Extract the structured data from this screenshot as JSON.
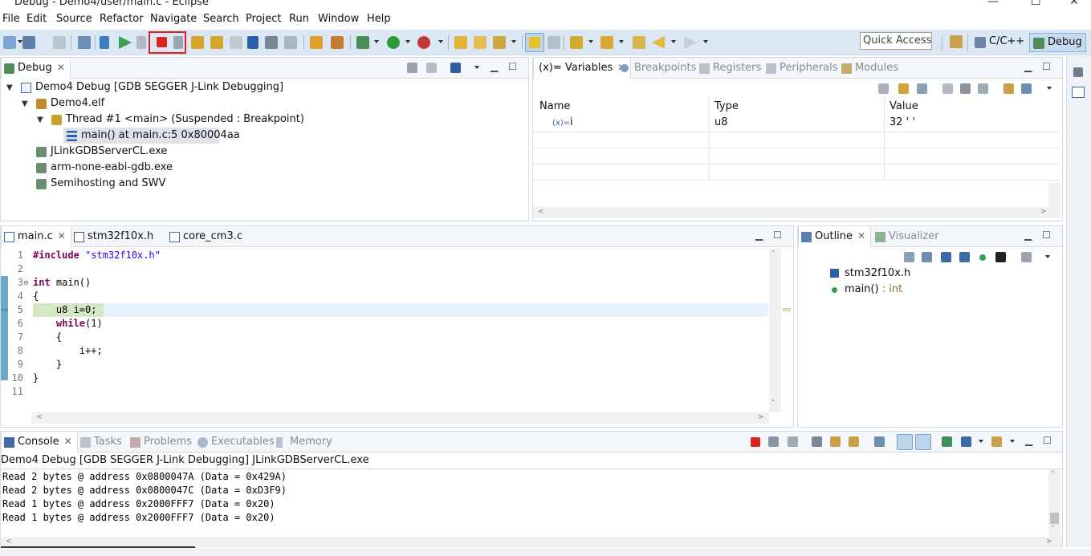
{
  "window": {
    "title": "Debug - Demo4/user/main.c - Eclipse"
  },
  "menu": [
    "File",
    "Edit",
    "Source",
    "Refactor",
    "Navigate",
    "Search",
    "Project",
    "Run",
    "Window",
    "Help"
  ],
  "toolbar": {
    "quick_access_placeholder": "Quick Access",
    "perspectives": [
      "C/C++",
      "Debug"
    ],
    "active_perspective": "Debug",
    "highlighted_button": "terminate-button"
  },
  "debug_view": {
    "tab_label": "Debug",
    "tree": [
      {
        "label": "Demo4 Debug [GDB SEGGER J-Link Debugging]",
        "level": 0,
        "icon": "launch-config-icon"
      },
      {
        "label": "Demo4.elf",
        "level": 1,
        "icon": "process-icon"
      },
      {
        "label": "Thread #1 <main> (Suspended : Breakpoint)",
        "level": 2,
        "icon": "thread-icon"
      },
      {
        "label": "main() at main.c:5 0x80004aa",
        "level": 3,
        "icon": "stack-frame-icon",
        "selected": true
      },
      {
        "label": "JLinkGDBServerCL.exe",
        "level": 1,
        "icon": "process-icon"
      },
      {
        "label": "arm-none-eabi-gdb.exe",
        "level": 1,
        "icon": "process-icon"
      },
      {
        "label": "Semihosting and SWV",
        "level": 1,
        "icon": "process-icon"
      }
    ]
  },
  "variables_view": {
    "tabs": [
      {
        "label": "(x)= Variables",
        "active": true
      },
      {
        "label": "Breakpoints",
        "active": false
      },
      {
        "label": "Registers",
        "active": false
      },
      {
        "label": "Peripherals",
        "active": false
      },
      {
        "label": "Modules",
        "active": false
      }
    ],
    "columns": [
      "Name",
      "Type",
      "Value"
    ],
    "rows": [
      {
        "icon_text": "(x)=",
        "name": "i",
        "type": "u8",
        "value": "32 ' '"
      }
    ]
  },
  "editor": {
    "tabs": [
      {
        "label": "main.c",
        "active": true
      },
      {
        "label": "stm32f10x.h",
        "active": false
      },
      {
        "label": "core_cm3.c",
        "active": false
      }
    ],
    "lines": [
      {
        "n": "1",
        "text": "#include \"stm32f10x.h\""
      },
      {
        "n": "2",
        "text": ""
      },
      {
        "n": "3",
        "text": "int main()"
      },
      {
        "n": "4",
        "text": "{"
      },
      {
        "n": "5",
        "text": "    u8 i=0;"
      },
      {
        "n": "6",
        "text": "    while(1)"
      },
      {
        "n": "7",
        "text": "    {"
      },
      {
        "n": "8",
        "text": "        i++;"
      },
      {
        "n": "9",
        "text": "    }"
      },
      {
        "n": "10",
        "text": "}"
      },
      {
        "n": "11",
        "text": ""
      }
    ],
    "current_line": "5"
  },
  "outline_view": {
    "tabs": [
      {
        "label": "Outline",
        "active": true
      },
      {
        "label": "Visualizer",
        "active": false
      }
    ],
    "items": [
      {
        "label": "stm32f10x.h",
        "suffix": "",
        "icon": "include-icon"
      },
      {
        "label": "main()",
        "suffix": " : int",
        "icon": "function-icon"
      }
    ]
  },
  "console_view": {
    "tabs": [
      {
        "label": "Console",
        "active": true
      },
      {
        "label": "Tasks",
        "active": false
      },
      {
        "label": "Problems",
        "active": false
      },
      {
        "label": "Executables",
        "active": false
      },
      {
        "label": "Memory",
        "active": false
      }
    ],
    "header": "Demo4 Debug [GDB SEGGER J-Link Debugging] JLinkGDBServerCL.exe",
    "lines": [
      "Read 2 bytes @ address 0x0800047A (Data = 0x429A)",
      "Read 2 bytes @ address 0x0800047C (Data = 0xD3F9)",
      "Read 1 bytes @ address 0x2000FFF7 (Data = 0x20)",
      "Read 1 bytes @ address 0x2000FFF7 (Data = 0x20)"
    ]
  },
  "colors": {
    "toolbar_bg": "#dbe8f4",
    "current_line_bg": "#e8f2fe",
    "current_line_code_bg": "#d4e8c4",
    "keyword": "#7f0055",
    "string": "#2a00ff",
    "highlight_box": "#e02020"
  }
}
